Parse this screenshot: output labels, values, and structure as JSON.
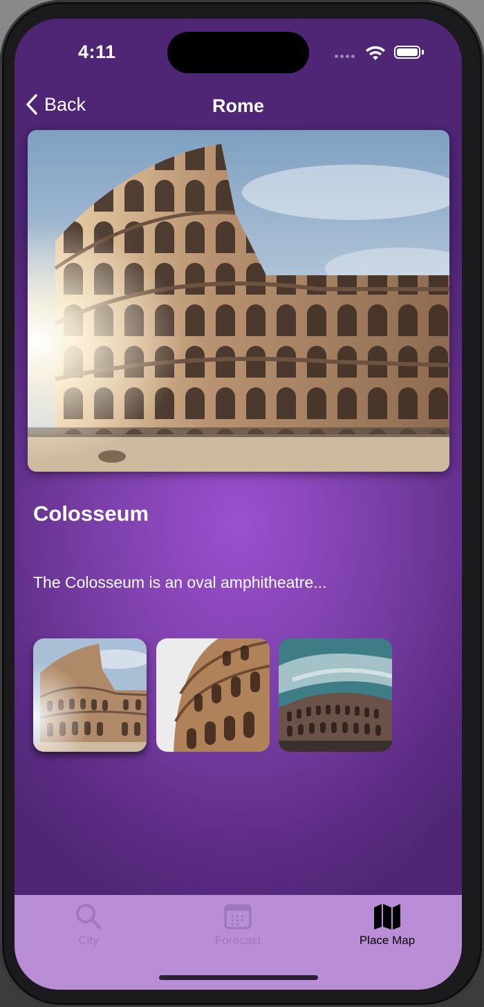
{
  "status_bar": {
    "time": "4:11"
  },
  "nav": {
    "back_label": "Back",
    "title": "Rome"
  },
  "place": {
    "name": "Colosseum",
    "description": "The Colosseum is an oval amphitheatre..."
  },
  "tabs": [
    {
      "label": "City",
      "icon": "search-icon",
      "active": false
    },
    {
      "label": "Forecast",
      "icon": "calendar-icon",
      "active": false
    },
    {
      "label": "Place Map",
      "icon": "map-icon",
      "active": true
    }
  ],
  "colors": {
    "background_center": "#9c50cf",
    "background_edge": "#4e2675",
    "tab_bar": "#b98ed7",
    "tab_inactive": "#9f77bf",
    "tab_active": "#000000"
  }
}
